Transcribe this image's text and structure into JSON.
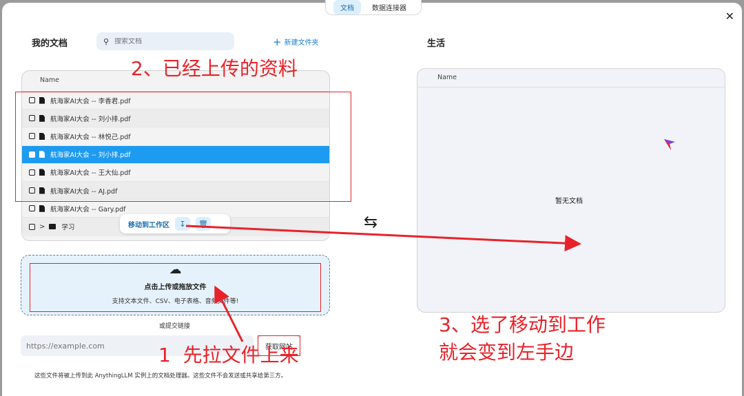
{
  "tabs": [
    "文档",
    "数据连接器"
  ],
  "active_tab": "文档",
  "left": {
    "title": "我的文档",
    "search_placeholder": "搜索文档",
    "new_folder": "新建文件夹",
    "column": "Name",
    "files": [
      "航海家AI大会 -- 李香君.pdf",
      "航海家AI大会 -- 刘小排.pdf",
      "航海家AI大会 -- 林悦己.pdf",
      "航海家AI大会 -- 刘小排.pdf",
      "航海家AI大会 -- 王大仙.pdf",
      "航海家AI大会 -- AJ.pdf",
      "航海家AI大会 -- Gary.pdf"
    ],
    "selected_index": 3,
    "folder": "学习",
    "move_to_workspace": "移动到工作区"
  },
  "upload": {
    "title": "点击上传或拖放文件",
    "subtitle": "支持文本文件、CSV、电子表格、音频文件等!",
    "or_link": "或提交链接",
    "url_placeholder": "https://example.com",
    "fetch": "获取网站",
    "disclaimer": "这些文件将被上传到此 AnythingLLM 实例上的文档处理器。这些文件不会发送或共享给第三方。"
  },
  "right": {
    "title": "生活",
    "column": "Name",
    "empty": "暂无文档"
  },
  "annotations": {
    "a1": "1  先拉文件上来",
    "a2": "2、已经上传的资料",
    "a3_line1": "3、选了移动到工作",
    "a3_line2": "就会变到左手边"
  },
  "colors": {
    "accent": "#1d9bf0",
    "annotation": "#e8222a"
  }
}
